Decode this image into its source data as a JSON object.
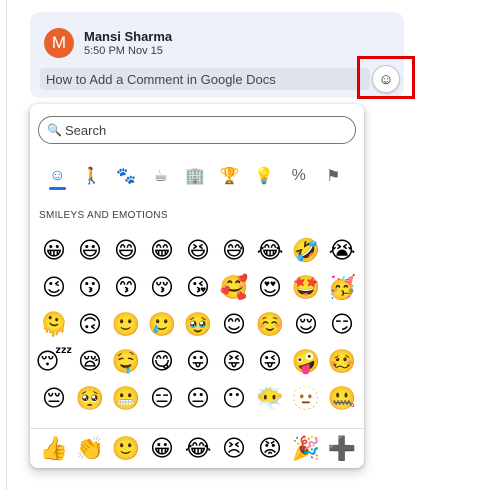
{
  "comment": {
    "avatar_initial": "M",
    "author": "Mansi Sharma",
    "timestamp": "5:50 PM Nov 15",
    "text": "How to Add a Comment in Google Docs",
    "emoji_button_glyph": "☺"
  },
  "picker": {
    "search_placeholder": "Search",
    "search_icon": "🔍",
    "categories": [
      {
        "name": "smileys",
        "glyph": "☺"
      },
      {
        "name": "people",
        "glyph": "🚶"
      },
      {
        "name": "animals-nature",
        "glyph": "🐾"
      },
      {
        "name": "food-drink",
        "glyph": "☕"
      },
      {
        "name": "travel-places",
        "glyph": "🏢"
      },
      {
        "name": "activities",
        "glyph": "🏆"
      },
      {
        "name": "objects",
        "glyph": "💡"
      },
      {
        "name": "symbols",
        "glyph": "%"
      },
      {
        "name": "flags",
        "glyph": "⚑"
      }
    ],
    "section_title": "SMILEYS AND EMOTIONS",
    "emojis": [
      "😀",
      "😃",
      "😄",
      "😁",
      "😆",
      "😅",
      "😂",
      "🤣",
      "😭",
      "😉",
      "😗",
      "😙",
      "😚",
      "😘",
      "🥰",
      "😍",
      "🤩",
      "🥳",
      "🫠",
      "🙃",
      "🙂",
      "🥲",
      "🥹",
      "😊",
      "☺️",
      "😌",
      "😏",
      "😴",
      "😪",
      "🤤",
      "😋",
      "😛",
      "😝",
      "😜",
      "🤪",
      "🥴",
      "😔",
      "🥺",
      "😬",
      "😑",
      "😐",
      "😶",
      "😶‍🌫️",
      "🫥",
      "🤐"
    ],
    "quick_emojis": [
      "👍",
      "👏",
      "🙂",
      "😀",
      "😂",
      "😣",
      "😡",
      "🎉",
      "➕"
    ]
  },
  "colors": {
    "accent": "#1a73e8",
    "highlight": "#e00000",
    "avatar": "#e8622c",
    "card": "#edf2fa"
  }
}
